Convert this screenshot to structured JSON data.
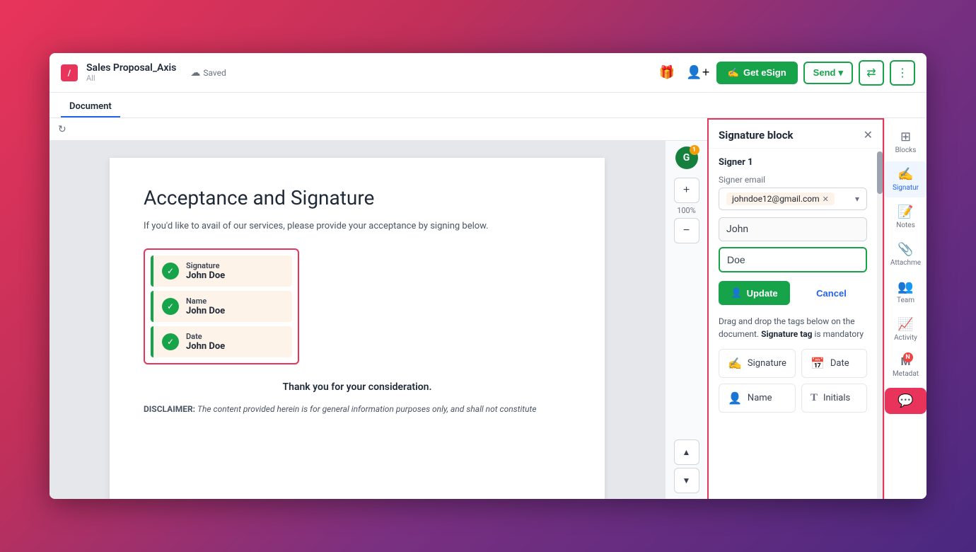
{
  "topbar": {
    "logo_text": "/",
    "doc_title": "Sales Proposal_Axis",
    "doc_subtitle": "All",
    "saved_label": "Saved",
    "get_esign_label": "Get eSign",
    "send_label": "Send",
    "gift_icon": "🎁",
    "user_icon": "👤"
  },
  "subnav": {
    "active_tab": "Document"
  },
  "doc": {
    "refresh_tooltip": "Refresh",
    "heading": "Acceptance and Signature",
    "paragraph": "If you'd like to avail of our services, please provide your acceptance by signing below.",
    "sig_blocks": [
      {
        "label": "Signature",
        "name": "John Doe"
      },
      {
        "label": "Name",
        "name": "John Doe"
      },
      {
        "label": "Date",
        "name": "John Doe"
      }
    ],
    "thank_you": "Thank you for your consideration.",
    "disclaimer_label": "DISCLAIMER:",
    "disclaimer_text": " The content provided herein is for general information purposes only, and shall not constitute"
  },
  "zoom": {
    "level": "100%"
  },
  "sig_panel": {
    "title": "Signature block",
    "signer_title": "Signer 1",
    "email_label": "Signer email",
    "email_value": "johndoe12@gmail.com",
    "first_name": "John",
    "last_name_placeholder": "Doe",
    "update_label": "Update",
    "cancel_label": "Cancel",
    "drag_hint_prefix": "Drag and drop the tags below on the document. ",
    "drag_hint_bold": "Signature tag",
    "drag_hint_suffix": " is mandatory",
    "tags": [
      {
        "icon": "✍️",
        "label": "Signature"
      },
      {
        "icon": "📅",
        "label": "Date"
      },
      {
        "icon": "👤",
        "label": "Name"
      },
      {
        "icon": "T",
        "label": "Initials"
      }
    ]
  },
  "right_sidebar": {
    "items": [
      {
        "id": "blocks",
        "icon": "⊞",
        "label": "Blocks"
      },
      {
        "id": "signature",
        "icon": "✍",
        "label": "Signatur",
        "active": true
      },
      {
        "id": "notes",
        "icon": "📝",
        "label": "Notes"
      },
      {
        "id": "attachments",
        "icon": "📎",
        "label": "Attachme"
      },
      {
        "id": "team",
        "icon": "👥",
        "label": "Team"
      },
      {
        "id": "activity",
        "icon": "📈",
        "label": "Activity"
      },
      {
        "id": "metadata",
        "icon": "M",
        "label": "Metadat",
        "badge": "N"
      },
      {
        "id": "chat",
        "icon": "💬",
        "label": ""
      }
    ]
  }
}
